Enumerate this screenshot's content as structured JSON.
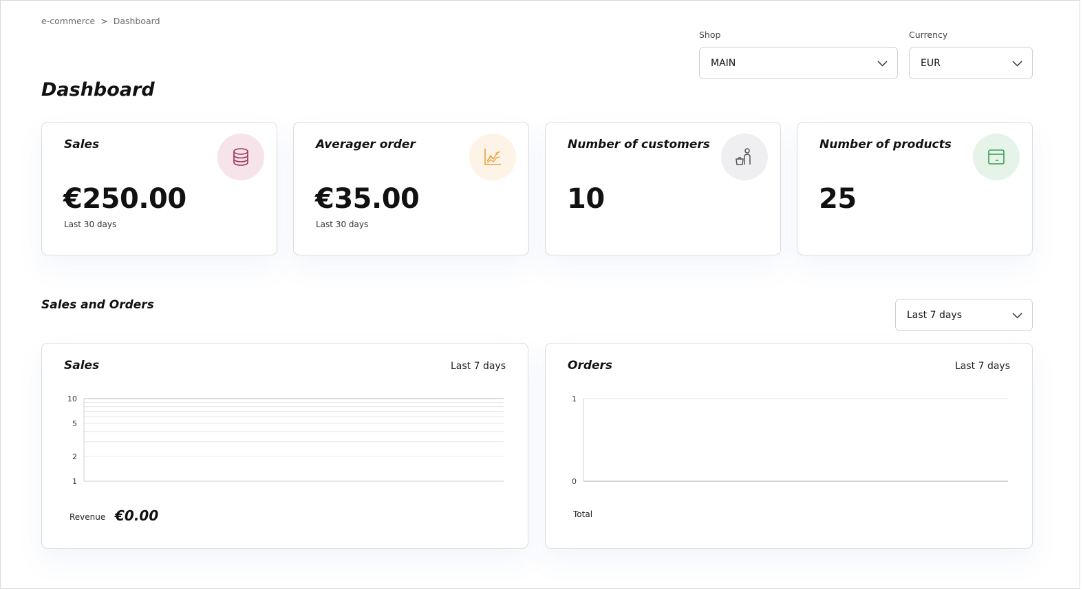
{
  "breadcrumb": {
    "root": "e-commerce",
    "separator": ">",
    "current": "Dashboard"
  },
  "filters": {
    "shop": {
      "label": "Shop",
      "value": "MAIN"
    },
    "currency": {
      "label": "Currency",
      "value": "EUR"
    }
  },
  "page_title": "Dashboard",
  "stats": [
    {
      "title": "Sales",
      "value": "€250.00",
      "sub": "Last 30 days",
      "icon": "database-icon",
      "icon_bg": "#f6e4ea",
      "icon_color": "#a3305a"
    },
    {
      "title": "Averager order",
      "value": "€35.00",
      "sub": "Last 30 days",
      "icon": "line-chart-icon",
      "icon_bg": "#fdf3e6",
      "icon_color": "#e8a33b"
    },
    {
      "title": "Number of customers",
      "value": "10",
      "sub": "",
      "icon": "person-basket-icon",
      "icon_bg": "#efeff1",
      "icon_color": "#555555"
    },
    {
      "title": "Number of products",
      "value": "25",
      "sub": "",
      "icon": "box-icon",
      "icon_bg": "#e6f3e8",
      "icon_color": "#3f9a55"
    }
  ],
  "section": {
    "title": "Sales and Orders",
    "range_select": "Last 7 days"
  },
  "charts": {
    "sales": {
      "title": "Sales",
      "range": "Last 7 days",
      "revenue_label": "Revenue",
      "revenue_value": "€0.00"
    },
    "orders": {
      "title": "Orders",
      "range": "Last 7 days",
      "total_label": "Total"
    }
  },
  "chart_data": [
    {
      "type": "line",
      "title": "Sales",
      "yscale": "log",
      "ylim": [
        1,
        10
      ],
      "yticks": [
        "10",
        "5",
        "2",
        "1"
      ],
      "series": [],
      "grid": true
    },
    {
      "type": "line",
      "title": "Orders",
      "ylim": [
        0,
        1
      ],
      "yticks": [
        "1",
        "0"
      ],
      "series": [],
      "grid": true
    }
  ]
}
